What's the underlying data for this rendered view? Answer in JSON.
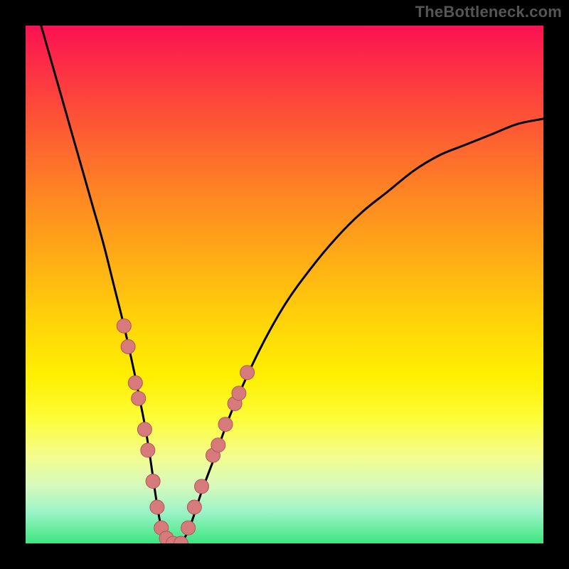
{
  "watermark": "TheBottleneck.com",
  "chart_data": {
    "type": "line",
    "title": "",
    "xlabel": "",
    "ylabel": "",
    "xlim": [
      0,
      100
    ],
    "ylim": [
      0,
      100
    ],
    "gradient_stops": [
      {
        "pct": 0,
        "color": "#fb1152"
      },
      {
        "pct": 8,
        "color": "#fc2f45"
      },
      {
        "pct": 20,
        "color": "#fd5a33"
      },
      {
        "pct": 33,
        "color": "#fe8723"
      },
      {
        "pct": 46,
        "color": "#ffb015"
      },
      {
        "pct": 58,
        "color": "#ffd609"
      },
      {
        "pct": 68,
        "color": "#fff002"
      },
      {
        "pct": 76,
        "color": "#fdfd3a"
      },
      {
        "pct": 83,
        "color": "#f4fc8c"
      },
      {
        "pct": 89,
        "color": "#d6fabd"
      },
      {
        "pct": 94,
        "color": "#9bf3c7"
      },
      {
        "pct": 100,
        "color": "#3de57f"
      }
    ],
    "series": [
      {
        "name": "bottleneck-curve",
        "stroke": "#000000",
        "stroke_width": 3,
        "x": [
          3,
          5,
          7,
          9,
          11,
          13,
          15,
          17,
          19,
          21,
          22,
          23,
          24,
          25,
          26,
          27,
          28,
          30,
          32,
          34,
          37,
          40,
          45,
          50,
          55,
          60,
          65,
          70,
          75,
          80,
          85,
          90,
          95,
          100
        ],
        "y": [
          100,
          93,
          86,
          79,
          72,
          65,
          58,
          50,
          42,
          33,
          28,
          23,
          17,
          10,
          4,
          1,
          0,
          0,
          4,
          10,
          18,
          26,
          37,
          46,
          53,
          59,
          64,
          68,
          72,
          75,
          77,
          79,
          81,
          82
        ]
      }
    ],
    "markers": {
      "name": "highlighted-points",
      "fill": "#d77a7c",
      "stroke": "#b25559",
      "radius": 10,
      "points": [
        {
          "x": 19.0,
          "y": 42
        },
        {
          "x": 19.8,
          "y": 38
        },
        {
          "x": 21.2,
          "y": 31
        },
        {
          "x": 21.8,
          "y": 28
        },
        {
          "x": 23.0,
          "y": 22
        },
        {
          "x": 23.6,
          "y": 18
        },
        {
          "x": 24.6,
          "y": 12
        },
        {
          "x": 25.4,
          "y": 7
        },
        {
          "x": 26.2,
          "y": 3
        },
        {
          "x": 27.2,
          "y": 1
        },
        {
          "x": 28.5,
          "y": 0
        },
        {
          "x": 30.0,
          "y": 0
        },
        {
          "x": 31.4,
          "y": 3
        },
        {
          "x": 32.6,
          "y": 7
        },
        {
          "x": 34.0,
          "y": 11
        },
        {
          "x": 36.2,
          "y": 17
        },
        {
          "x": 37.2,
          "y": 19
        },
        {
          "x": 38.6,
          "y": 23
        },
        {
          "x": 40.4,
          "y": 27
        },
        {
          "x": 41.2,
          "y": 29
        },
        {
          "x": 42.8,
          "y": 33
        }
      ]
    }
  }
}
